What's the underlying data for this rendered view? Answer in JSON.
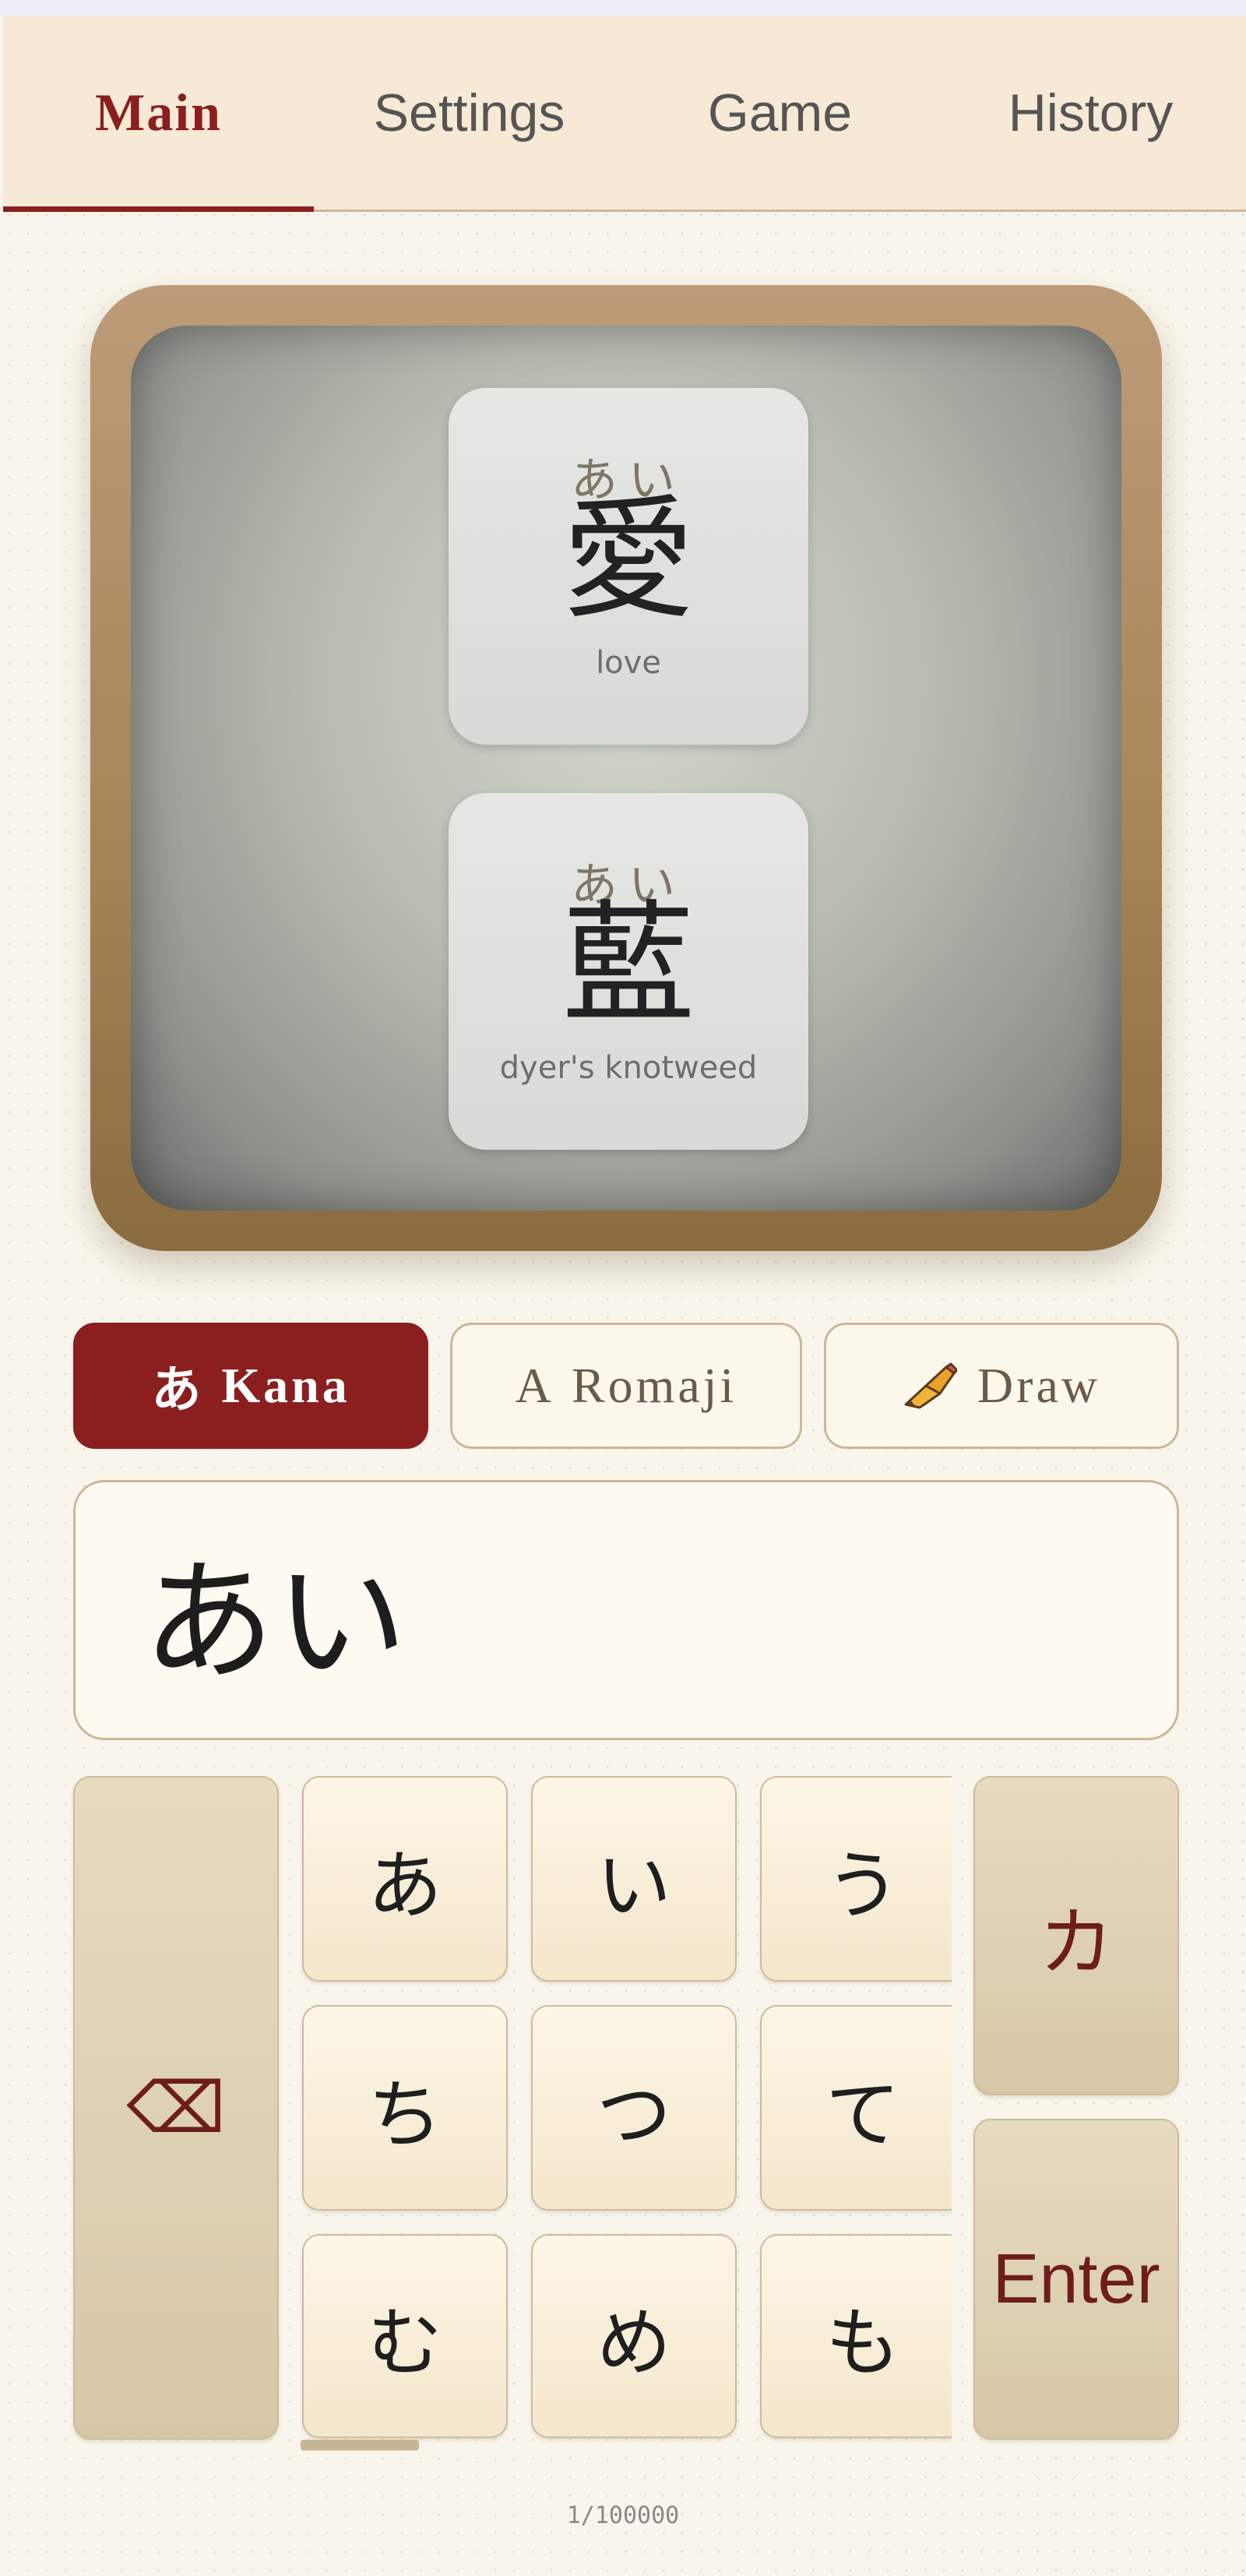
{
  "tabs": [
    {
      "label": "Main",
      "active": true
    },
    {
      "label": "Settings",
      "active": false
    },
    {
      "label": "Game",
      "active": false
    },
    {
      "label": "History",
      "active": false
    }
  ],
  "cards": [
    {
      "reading": "あい",
      "kanji": "愛",
      "meaning": "love"
    },
    {
      "reading": "あい",
      "kanji": "藍",
      "meaning": "dyer's knotweed"
    }
  ],
  "modes": {
    "kana": {
      "prefix": "あ",
      "label": "Kana"
    },
    "romaji": {
      "prefix": "A",
      "label": "Romaji"
    },
    "draw": {
      "label": "Draw",
      "icon": "pencil-icon"
    }
  },
  "input": {
    "value": "あい"
  },
  "keyboard": {
    "backspace": "⌫",
    "keys": [
      [
        "あ",
        "い",
        "う"
      ],
      [
        "ち",
        "つ",
        "て"
      ],
      [
        "む",
        "め",
        "も"
      ]
    ],
    "script_toggle": "カ",
    "enter": "Enter"
  },
  "counter": "1/100000",
  "colors": {
    "accent": "#8b1f1f",
    "tab_bg": "#f6ead6",
    "frame": "#a78658"
  }
}
